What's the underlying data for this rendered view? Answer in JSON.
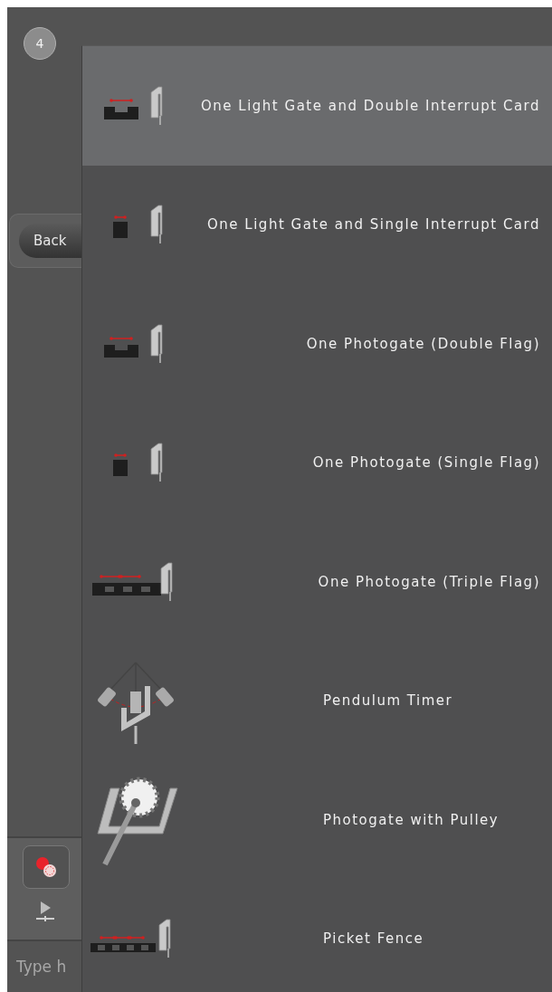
{
  "step": {
    "number": "4"
  },
  "back_button": {
    "label": "Back"
  },
  "input": {
    "placeholder": "Type h"
  },
  "timer_options": [
    {
      "label": "One Light Gate and Double Interrupt Card",
      "kind": "double",
      "selected": true
    },
    {
      "label": "One Light Gate and Single Interrupt Card",
      "kind": "single",
      "selected": false
    },
    {
      "label": "One Photogate (Double Flag)",
      "kind": "double",
      "selected": false
    },
    {
      "label": "One Photogate (Single Flag)",
      "kind": "single",
      "selected": false
    },
    {
      "label": "One Photogate (Triple Flag)",
      "kind": "triple",
      "selected": false
    },
    {
      "label": "Pendulum Timer",
      "kind": "pendulum",
      "selected": false
    },
    {
      "label": "Photogate with Pulley",
      "kind": "pulley",
      "selected": false
    },
    {
      "label": "Picket Fence",
      "kind": "picket",
      "selected": false
    }
  ]
}
